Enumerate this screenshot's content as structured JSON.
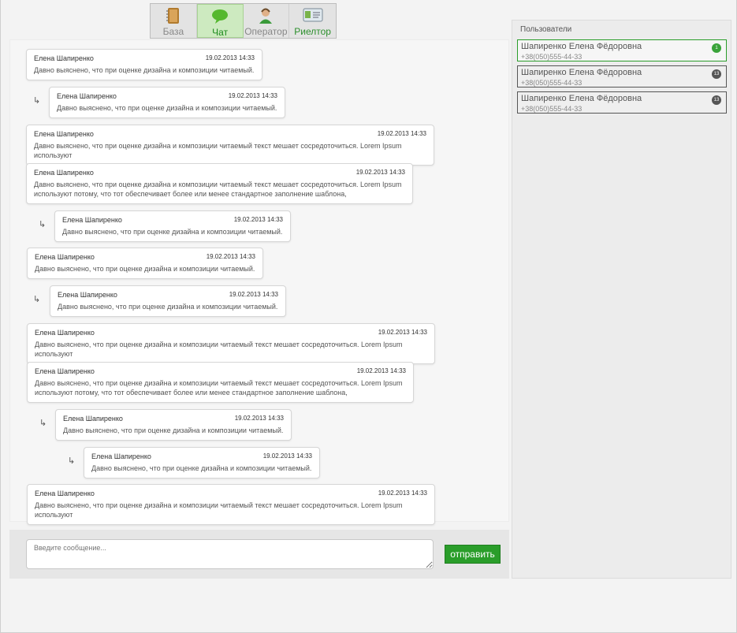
{
  "tabs": [
    {
      "label": "База",
      "icon": "notebook-icon"
    },
    {
      "label": "Чат",
      "icon": "chat-bubble-icon"
    },
    {
      "label": "Оператор",
      "icon": "operator-icon"
    },
    {
      "label": "Риелтор",
      "icon": "id-card-icon"
    }
  ],
  "messages": [
    {
      "author": "Елена Шапиренко",
      "date": "19.02.2013",
      "time": "14:33",
      "text": "Давно выяснено, что при оценке дизайна и композиции читаемый."
    },
    {
      "author": "Елена Шапиренко",
      "date": "19.02.2013",
      "time": "14:33",
      "text": "Давно выяснено, что при оценке дизайна и композиции читаемый."
    },
    {
      "author": "Елена Шапиренко",
      "date": "19.02.2013",
      "time": "14:33",
      "text": "Давно выяснено, что при оценке дизайна и композиции читаемый текст мешает сосредоточиться. Lorem Ipsum используют"
    },
    {
      "author": "Елена Шапиренко",
      "date": "19.02.2013",
      "time": "14:33",
      "text": "Давно выяснено, что при оценке дизайна и композиции читаемый текст мешает сосредоточиться. Lorem Ipsum используют потому, что тот обеспечивает более или менее стандартное заполнение шаблона,"
    },
    {
      "author": "Елена Шапиренко",
      "date": "19.02.2013",
      "time": "14:33",
      "text": "Давно выяснено, что при оценке дизайна и композиции читаемый."
    },
    {
      "author": "Елена Шапиренко",
      "date": "19.02.2013",
      "time": "14:33",
      "text": "Давно выяснено, что при оценке дизайна и композиции читаемый."
    },
    {
      "author": "Елена Шапиренко",
      "date": "19.02.2013",
      "time": "14:33",
      "text": "Давно выяснено, что при оценке дизайна и композиции читаемый."
    },
    {
      "author": "Елена Шапиренко",
      "date": "19.02.2013",
      "time": "14:33",
      "text": "Давно выяснено, что при оценке дизайна и композиции читаемый текст мешает сосредоточиться. Lorem Ipsum используют"
    },
    {
      "author": "Елена Шапиренко",
      "date": "19.02.2013",
      "time": "14:33",
      "text": "Давно выяснено, что при оценке дизайна и композиции читаемый текст мешает сосредоточиться. Lorem Ipsum используют потому, что тот обеспечивает более или менее стандартное заполнение шаблона,"
    },
    {
      "author": "Елена Шапиренко",
      "date": "19.02.2013",
      "time": "14:33",
      "text": "Давно выяснено, что при оценке дизайна и композиции читаемый."
    },
    {
      "author": "Елена Шапиренко",
      "date": "19.02.2013",
      "time": "14:33",
      "text": "Давно выяснено, что при оценке дизайна и композиции читаемый."
    },
    {
      "author": "Елена Шапиренко",
      "date": "19.02.2013",
      "time": "14:33",
      "text": "Давно выяснено, что при оценке дизайна и композиции читаемый текст мешает сосредоточиться. Lorem Ipsum используют"
    }
  ],
  "composer": {
    "placeholder": "Введите сообщение...",
    "send_label": "отправить"
  },
  "users": {
    "title": "Пользователи",
    "items": [
      {
        "name": "Шапиренко Елена Фёдоровна",
        "phone": "+38(050)555-44-33",
        "badge": "1"
      },
      {
        "name": "Шапиренко Елена Фёдоровна",
        "phone": "+38(050)555-44-33",
        "badge": "13"
      },
      {
        "name": "Шапиренко Елена Фёдоровна",
        "phone": "+38(050)555-44-33",
        "badge": "13"
      }
    ]
  },
  "colors": {
    "accent": "#2a9d2a",
    "active_tab": "#cdeac0"
  }
}
